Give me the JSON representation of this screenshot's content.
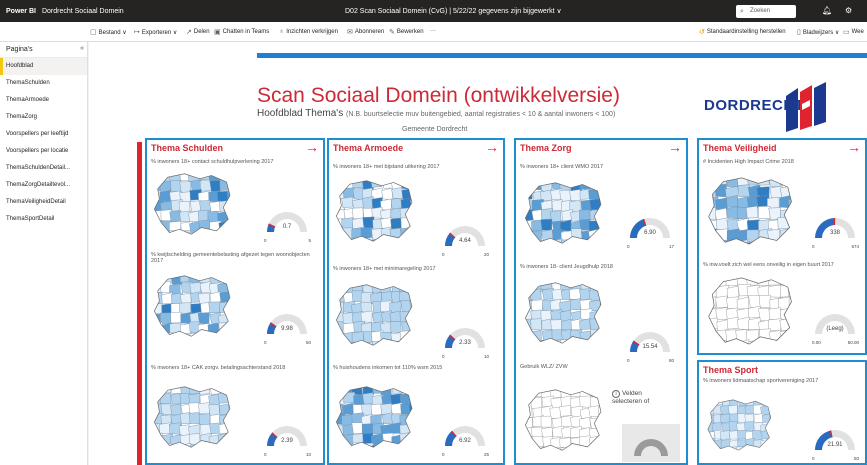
{
  "topbar": {
    "app": "Power BI",
    "workspace": "Dordrecht Sociaal Domein",
    "report_title": "D02 Scan Sociaal Domein (CvG)  |  5/22/22 gegevens zijn bijgewerkt  ∨",
    "search_placeholder": "Zoeken"
  },
  "toolbar": {
    "file": "Bestand ∨",
    "export": "Exporteren ∨",
    "share": "Delen",
    "teams": "Chatten in Teams",
    "insights": "Inzichten verkrijgen",
    "subscribe": "Abonneren",
    "edit": "Bewerken",
    "more": "···",
    "reset": "Standaardinstelling herstellen",
    "bookmarks": "Bladwijzers ∨",
    "view": "Wee"
  },
  "sidebar": {
    "header": "Pagina's",
    "items": [
      {
        "label": "Hoofdblad",
        "active": true
      },
      {
        "label": "ThemaSchulden"
      },
      {
        "label": "ThemaArmoede"
      },
      {
        "label": "ThemaZorg"
      },
      {
        "label": "Voorspellers per leeftijd"
      },
      {
        "label": "Voorspellers per locatie"
      },
      {
        "label": "ThemaSchuldenDetail..."
      },
      {
        "label": "ThemaZorgDetailtevol..."
      },
      {
        "label": "ThemaVeiligheidDetail"
      },
      {
        "label": "ThemaSportDetail"
      }
    ]
  },
  "report": {
    "title": "Scan Sociaal Domein (ontwikkelversie)",
    "subtitle": "Hoofdblad Thema's",
    "subtitle_note": "(N.B. buurtselectie muv buitengebied, aantal registraties  < 10 & aantal inwoners < 100)",
    "gemeente": "Gemeente Dordrecht",
    "logo_text": "DORDRECHT"
  },
  "colors": {
    "accent_red": "#e0242f",
    "panel_blue": "#1f8ed1",
    "brand_navy": "#1b3a8f",
    "gauge_fill": "#2a6bbf"
  },
  "panels": {
    "schulden": {
      "title": "Thema Schulden",
      "metrics": [
        {
          "label": "% inwoners 18+ contact schuldhulpverlening 2017",
          "value": "0.7",
          "min": "0",
          "max": "5"
        },
        {
          "label": "% kwijtschelding gemeentebelasting afgezet tegen woonobjecten 2017",
          "value": "9.98",
          "min": "0",
          "max": "50"
        },
        {
          "label": "% inwoners 18+ CAK zorgv. betalingsachterstand 2018",
          "value": "2.39",
          "min": "0",
          "max": "10"
        }
      ]
    },
    "armoede": {
      "title": "Thema Armoede",
      "metrics": [
        {
          "label": "% inwoners 18+ met bijstand uitkering 2017",
          "value": "4.64",
          "min": "0",
          "max": "20"
        },
        {
          "label": "% inwoners 18+ met minimaregeling 2017",
          "value": "2.33",
          "min": "0",
          "max": "10"
        },
        {
          "label": "% huishoudens inkomen tot 110% wsm 2015",
          "value": "6.92",
          "min": "0",
          "max": "25"
        }
      ]
    },
    "zorg": {
      "title": "Thema Zorg",
      "metrics": [
        {
          "label": "% inwoners 18+ client WMO 2017",
          "value": "6.90",
          "min": "0",
          "max": "17"
        },
        {
          "label": "% inwoners 18- client Jeugdhulp 2018",
          "value": "15.54",
          "min": "0",
          "max": "80"
        },
        {
          "label": "Gebruik WLZ/ ZVW",
          "value": "",
          "min": "",
          "max": ""
        }
      ],
      "info_line1": "Velden",
      "info_line2": "selecteren of"
    },
    "veiligheid": {
      "title": "Thema Veiligheid",
      "metrics": [
        {
          "label": "# Incidenten High Impact Crime 2018",
          "value": "338",
          "min": "0",
          "max": "674"
        },
        {
          "label": "% inw.voelt zich wel eens onveilig in eigen buurt 2017",
          "value": "(Leeg)",
          "min": "0.00",
          "max": "50.00"
        }
      ]
    },
    "sport": {
      "title": "Thema Sport",
      "metrics": [
        {
          "label": "% inwoners lidmaatschap sportvereniging 2017",
          "value": "21.91",
          "min": "0",
          "max": "50"
        }
      ]
    }
  }
}
